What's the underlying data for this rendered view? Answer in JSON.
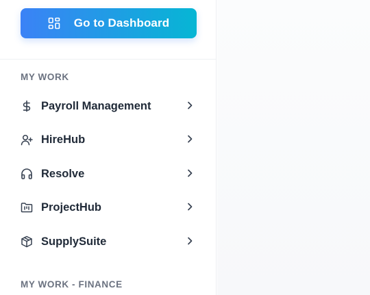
{
  "sidebar": {
    "dashboard_button": {
      "label": "Go to Dashboard",
      "icon": "dashboard-grid-icon"
    },
    "sections": [
      {
        "title": "MY WORK",
        "items": [
          {
            "label": "Payroll Management",
            "icon": "dollar-icon"
          },
          {
            "label": "HireHub",
            "icon": "user-plus-icon"
          },
          {
            "label": "Resolve",
            "icon": "headphones-icon"
          },
          {
            "label": "ProjectHub",
            "icon": "folder-kanban-icon"
          },
          {
            "label": "SupplySuite",
            "icon": "package-icon"
          }
        ]
      },
      {
        "title": "MY WORK - FINANCE",
        "items": []
      }
    ]
  },
  "colors": {
    "button_gradient_start": "#3b82f6",
    "button_gradient_end": "#06b6d4",
    "section_label": "#6b7280",
    "nav_text": "#1f2937"
  }
}
